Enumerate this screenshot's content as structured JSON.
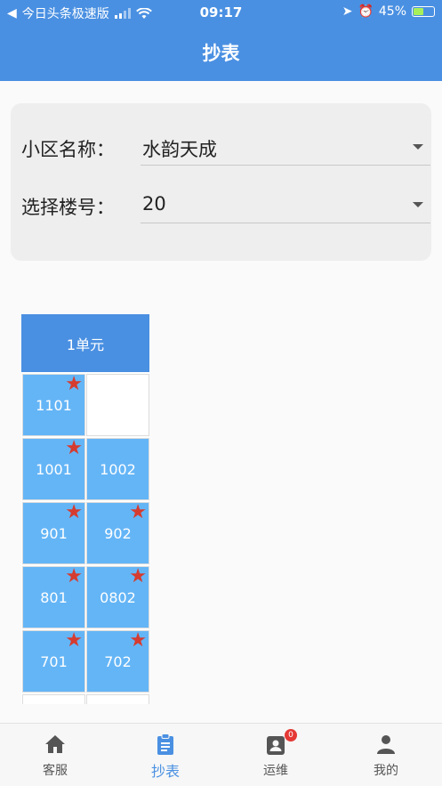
{
  "status_bar": {
    "back_app": "今日头条极速版",
    "time": "09:17",
    "battery": "45%"
  },
  "header": {
    "title": "抄表"
  },
  "filter": {
    "community_label": "小区名称：",
    "community_value": "水韵天成",
    "building_label": "选择楼号：",
    "building_value": "20"
  },
  "grid": {
    "unit_title": "1单元",
    "cells": [
      {
        "label": "1101",
        "starred": true
      },
      {
        "label": "",
        "starred": false,
        "empty": true
      },
      {
        "label": "1001",
        "starred": true
      },
      {
        "label": "1002",
        "starred": false
      },
      {
        "label": "901",
        "starred": true
      },
      {
        "label": "902",
        "starred": true
      },
      {
        "label": "801",
        "starred": true
      },
      {
        "label": "0802",
        "starred": true
      },
      {
        "label": "701",
        "starred": true
      },
      {
        "label": "702",
        "starred": true
      }
    ]
  },
  "tabs": [
    {
      "label": "客服",
      "icon": "home-icon",
      "active": false
    },
    {
      "label": "抄表",
      "icon": "clipboard-icon",
      "active": true
    },
    {
      "label": "运维",
      "icon": "contact-badge-icon",
      "active": false,
      "badge": "0"
    },
    {
      "label": "我的",
      "icon": "person-icon",
      "active": false
    }
  ],
  "colors": {
    "primary": "#4a90e2",
    "cell": "#64b5f6",
    "star": "#d63b2f"
  }
}
